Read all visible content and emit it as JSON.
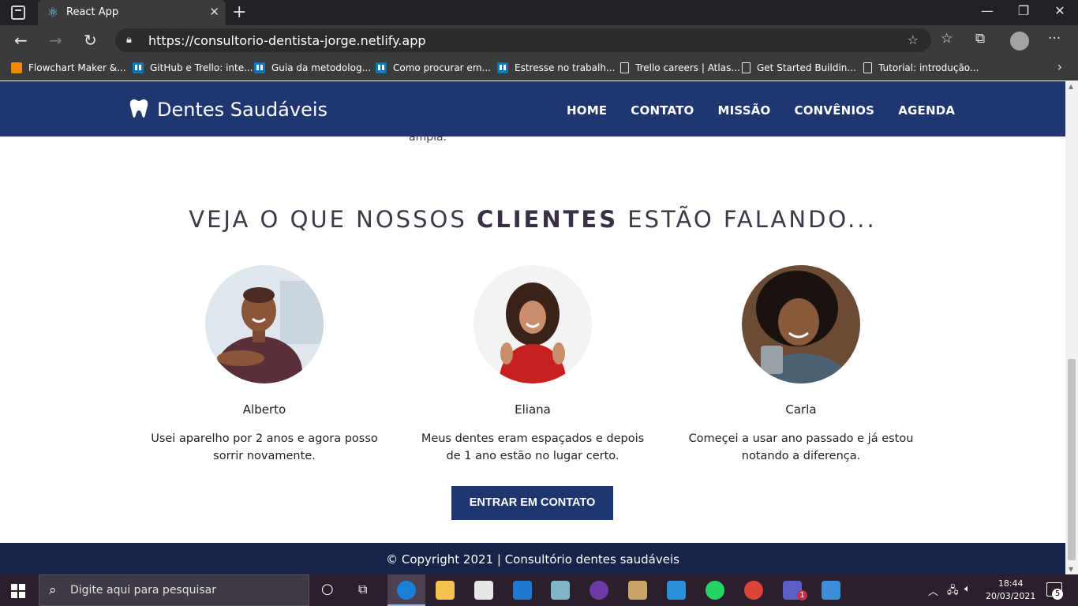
{
  "browser": {
    "tab_title": "React App",
    "url": "https://consultorio-dentista-jorge.netlify.app",
    "bookmarks": [
      {
        "label": "Flowchart Maker &...",
        "icon": "drawio-icon"
      },
      {
        "label": "GitHub e Trello: inte...",
        "icon": "trello-icon"
      },
      {
        "label": "Guia da metodolog...",
        "icon": "trello-icon"
      },
      {
        "label": "Como procurar em...",
        "icon": "trello-icon"
      },
      {
        "label": "Estresse no trabalh...",
        "icon": "trello-icon"
      },
      {
        "label": "Trello careers | Atlas...",
        "icon": "page-icon"
      },
      {
        "label": "Get Started Buildin...",
        "icon": "page-icon"
      },
      {
        "label": "Tutorial: introdução...",
        "icon": "page-icon"
      }
    ]
  },
  "site": {
    "brand": "Dentes Saudáveis",
    "nav": [
      "HOME",
      "CONTATO",
      "MISSÃO",
      "CONVÊNIOS",
      "AGENDA"
    ],
    "cut_text": "ampla.",
    "section_title_pre": "VEJA O QUE NOSSOS ",
    "section_title_bold": "CLIENTES",
    "section_title_post": " ESTÃO FALANDO...",
    "testimonials": [
      {
        "name": "Alberto",
        "quote": "Usei aparelho por 2 anos e agora posso sorrir novamente."
      },
      {
        "name": "Eliana",
        "quote": "Meus dentes eram espaçados e depois de 1 ano estão no lugar certo."
      },
      {
        "name": "Carla",
        "quote": "Começei a usar ano passado e já estou notando a diferença."
      }
    ],
    "cta_label": "ENTRAR EM CONTATO",
    "footer": "© Copyright 2021 | Consultório dentes saudáveis"
  },
  "taskbar": {
    "search_placeholder": "Digite aqui para pesquisar",
    "time": "18:44",
    "date": "20/03/2021",
    "notification_count": "5",
    "teams_badge": "1"
  },
  "colors": {
    "navbar": "#1f3670",
    "footer": "#172348",
    "cta": "#1f3670"
  }
}
